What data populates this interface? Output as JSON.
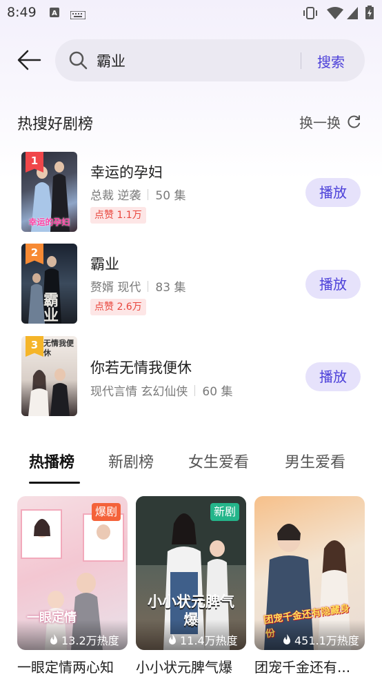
{
  "status_bar": {
    "time": "8:49"
  },
  "search": {
    "value": "霸业",
    "button_label": "搜索"
  },
  "hot_section": {
    "title": "热搜好剧榜",
    "refresh_label": "换一换"
  },
  "ranking": [
    {
      "rank": "1",
      "title": "幸运的孕妇",
      "tags": "总裁 逆袭",
      "episodes": "50 集",
      "likes": "点赞 1.1万",
      "play_label": "播放",
      "badge_color": "#f0474a",
      "cover_text": "幸运的孕妇"
    },
    {
      "rank": "2",
      "title": "霸业",
      "tags": "赘婿 现代",
      "episodes": "83 集",
      "likes": "点赞 2.6万",
      "play_label": "播放",
      "badge_color": "#f78a34",
      "cover_text": "霸业"
    },
    {
      "rank": "3",
      "title": "你若无情我便休",
      "tags": "现代言情 玄幻仙侠",
      "episodes": "60 集",
      "likes": "",
      "play_label": "播放",
      "badge_color": "#f5b529",
      "cover_text": "无情我便休"
    }
  ],
  "tabs": [
    "热播榜",
    "新剧榜",
    "女生爱看",
    "男生爱看"
  ],
  "active_tab": 0,
  "cards": [
    {
      "title": "一眼定情两心知",
      "tag": "爆剧",
      "tag_color": "#f4623a",
      "heat": "13.2万热度",
      "cover_text": "一眼定情"
    },
    {
      "title": "小小状元脾气爆",
      "tag": "新剧",
      "tag_color": "#24b58a",
      "heat": "11.4万热度",
      "cover_text": "小小状元脾气爆"
    },
    {
      "title": "团宠千金还有...",
      "tag": "",
      "tag_color": "",
      "heat": "451.1万热度",
      "cover_text": "团宠千金还有隐藏身份"
    }
  ],
  "colors": {
    "accent": "#4b3fd9",
    "play_bg": "#e6e2fb",
    "like_bg": "#fde6e6",
    "like_text": "#e8453c"
  }
}
